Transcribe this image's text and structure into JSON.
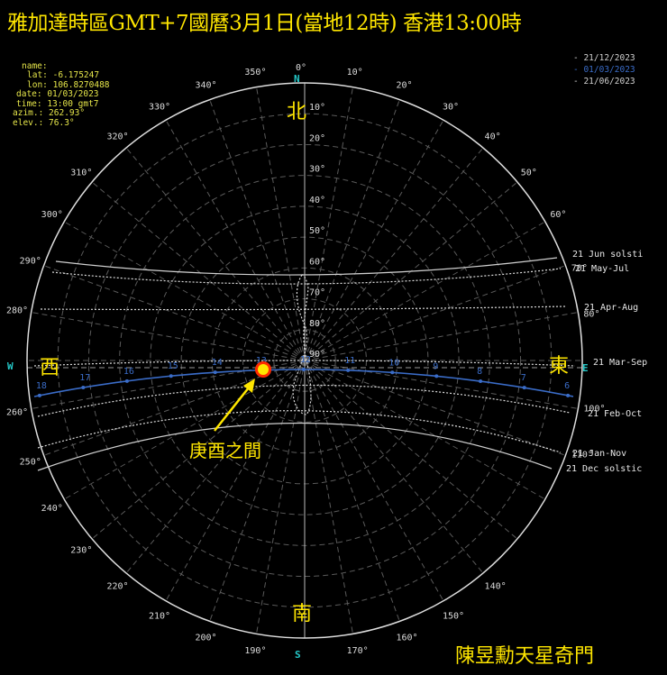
{
  "title": "雅加達時區GMT+7國曆3月1日(當地12時) 香港13:00時",
  "info": {
    "name": "name:",
    "lat": "lat: -6.175247",
    "lon": "lon: 106.8270488",
    "date": "date: 01/03/2023",
    "time": "time: 13:00 gmt7",
    "azim": "azim.: 262.93°",
    "elev": "elev.: 76.3°"
  },
  "legend": [
    {
      "label": "- 21/12/2023",
      "color": "#d0d0d0"
    },
    {
      "label": "- 01/03/2023",
      "color": "#3a6cc8"
    },
    {
      "label": "- 21/06/2023",
      "color": "#d0d0d0"
    }
  ],
  "compass": {
    "N": "N",
    "E": "E",
    "S": "S",
    "W": "W"
  },
  "azimuth_labels": [
    "0°",
    "10°",
    "20°",
    "30°",
    "40°",
    "50°",
    "60°",
    "70°",
    "80°",
    "100°",
    "110°",
    "140°",
    "150°",
    "160°",
    "170°",
    "190°",
    "200°",
    "210°",
    "220°",
    "230°",
    "240°",
    "250°",
    "260°",
    "280°",
    "290°",
    "300°",
    "310°",
    "320°",
    "330°",
    "340°",
    "350°"
  ],
  "altitude_labels": [
    "10°",
    "20°",
    "30°",
    "40°",
    "50°",
    "60°",
    "70°",
    "80°",
    "90°"
  ],
  "curve_labels": {
    "jun": "21 Jun  solsti",
    "mayjul": "21 May-Jul",
    "apraug": "21 Apr-Aug",
    "marsep": "21 Mar-Sep",
    "febokt": "21 Feb-Oct",
    "jannov": "21 Jan-Nov",
    "dec": "21 Dec  solstic"
  },
  "hour_labels": [
    "18",
    "17",
    "16",
    "15",
    "14",
    "13",
    "12",
    "11",
    "10",
    "9",
    "8",
    "7",
    "6"
  ],
  "directions_cn": {
    "north": "北",
    "west": "西",
    "east": "東",
    "south": "南"
  },
  "annotation": "庚酉之間",
  "brand": "陳昱勳天星奇門",
  "colors": {
    "accent": "#ffe600",
    "current_path": "#3a6cc8",
    "sun": "#ff2a00",
    "grid": "#7a7a7a",
    "compass": "#25c8c8"
  }
}
